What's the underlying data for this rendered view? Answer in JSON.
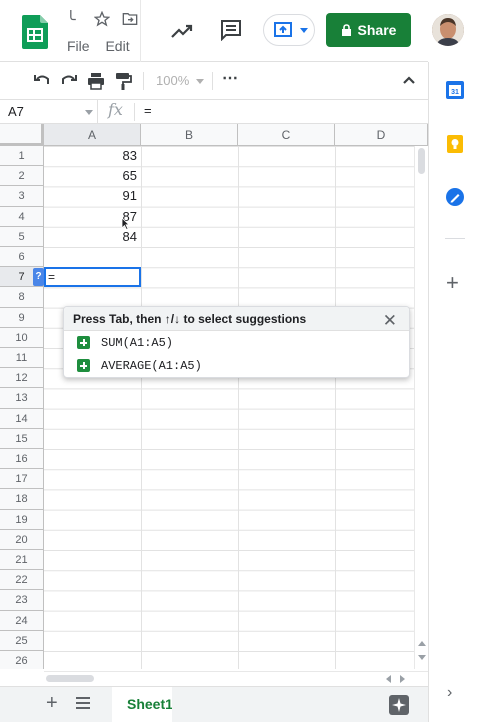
{
  "menus": [
    "File",
    "Edit"
  ],
  "share_label": "Share",
  "zoom": "100%",
  "namebox": "A7",
  "formula_text": "=",
  "columns": [
    "A",
    "B",
    "C",
    "D"
  ],
  "rows": [
    "1",
    "2",
    "3",
    "4",
    "5",
    "6",
    "7",
    "8",
    "9",
    "10",
    "11",
    "12",
    "13",
    "14",
    "15",
    "16",
    "17",
    "18",
    "19",
    "20",
    "21",
    "22",
    "23",
    "24",
    "25",
    "26"
  ],
  "cells": [
    {
      "ref": "A1",
      "value": "83"
    },
    {
      "ref": "A2",
      "value": "65"
    },
    {
      "ref": "A3",
      "value": "91"
    },
    {
      "ref": "A4",
      "value": "87"
    },
    {
      "ref": "A5",
      "value": "84"
    }
  ],
  "active_cell": {
    "ref": "A7",
    "value": "="
  },
  "help_badge": "?",
  "suggestions": {
    "header": "Press Tab, then ↑/↓ to select suggestions",
    "items": [
      "SUM(A1:A5)",
      "AVERAGE(A1:A5)"
    ]
  },
  "sheet_tab": "Sheet1",
  "colors": {
    "brand_green": "#188038",
    "selection_blue": "#1a73e8",
    "calendar_blue": "#1a73e8",
    "keep_yellow": "#fbbc04",
    "tasks_blue": "#1a73e8"
  },
  "icons": [
    "sheets-logo-icon",
    "star-icon",
    "move-folder-icon",
    "trend-icon",
    "comment-icon",
    "present-icon",
    "lock-icon",
    "undo-icon",
    "redo-icon",
    "print-icon",
    "paint-format-icon",
    "more-icon",
    "chevron-up-icon",
    "fx-icon",
    "close-icon",
    "add-sheet-icon",
    "all-sheets-icon",
    "explore-icon",
    "calendar-icon",
    "keep-icon",
    "tasks-icon",
    "add-icon",
    "chevron-right-icon"
  ]
}
